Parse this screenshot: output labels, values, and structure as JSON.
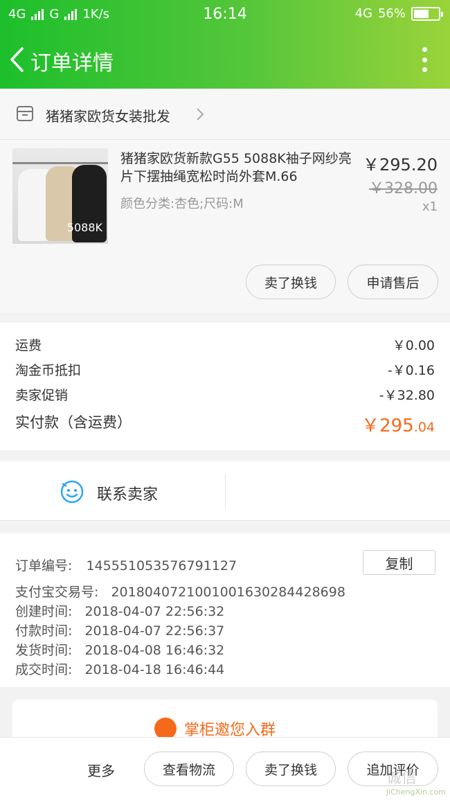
{
  "status_bar": {
    "network1": "4G",
    "network2": "G",
    "speed": "1K/s",
    "time": "16:14",
    "network3": "4G",
    "battery": "56%"
  },
  "nav": {
    "title": "订单详情"
  },
  "shop": {
    "name": "猪猪家欧货女装批发"
  },
  "product": {
    "title": "猪猪家欧货新款G55 5088K袖子网纱亮片下摆抽绳宽松时尚外套M.66",
    "spec": "颜色分类:杏色;尺码:M",
    "price": "￥295.20",
    "original_price": "￥328.00",
    "quantity": "x1",
    "image_watermark": "5088K",
    "buttons": {
      "sell": "卖了换钱",
      "after_sale": "申请售后"
    }
  },
  "fees": [
    {
      "label": "运费",
      "value": "￥0.00"
    },
    {
      "label": "淘金币抵扣",
      "value": "-￥0.16"
    },
    {
      "label": "卖家促销",
      "value": "-￥32.80"
    }
  ],
  "total": {
    "label": "实付款（含运费）",
    "main": "￥295",
    "cents": ".04"
  },
  "contact": {
    "label": "联系卖家"
  },
  "order_info": {
    "copy_label": "复制",
    "rows": [
      {
        "label": "订单编号:",
        "value": "145551053576791127"
      },
      {
        "label": "支付宝交易号:",
        "value": "2018040721001001630284428698"
      },
      {
        "label": "创建时间:",
        "value": "2018-04-07 22:56:32"
      },
      {
        "label": "付款时间:",
        "value": "2018-04-07 22:56:37"
      },
      {
        "label": "发货时间:",
        "value": "2018-04-08 16:46:32"
      },
      {
        "label": "成交时间:",
        "value": "2018-04-18 16:46:44"
      }
    ]
  },
  "group_banner": {
    "text": "掌柜邀您入群"
  },
  "bottom_bar": {
    "more": "更多",
    "logistics": "查看物流",
    "sell": "卖了换钱",
    "review": "追加评价"
  },
  "watermark": {
    "text": "诚信",
    "sub": "JiChengXin.com"
  },
  "colors": {
    "accent": "#f56a1a",
    "header_start": "#1dbf2c",
    "header_end": "#9ad33a",
    "contact_icon": "#2aa7f5"
  }
}
